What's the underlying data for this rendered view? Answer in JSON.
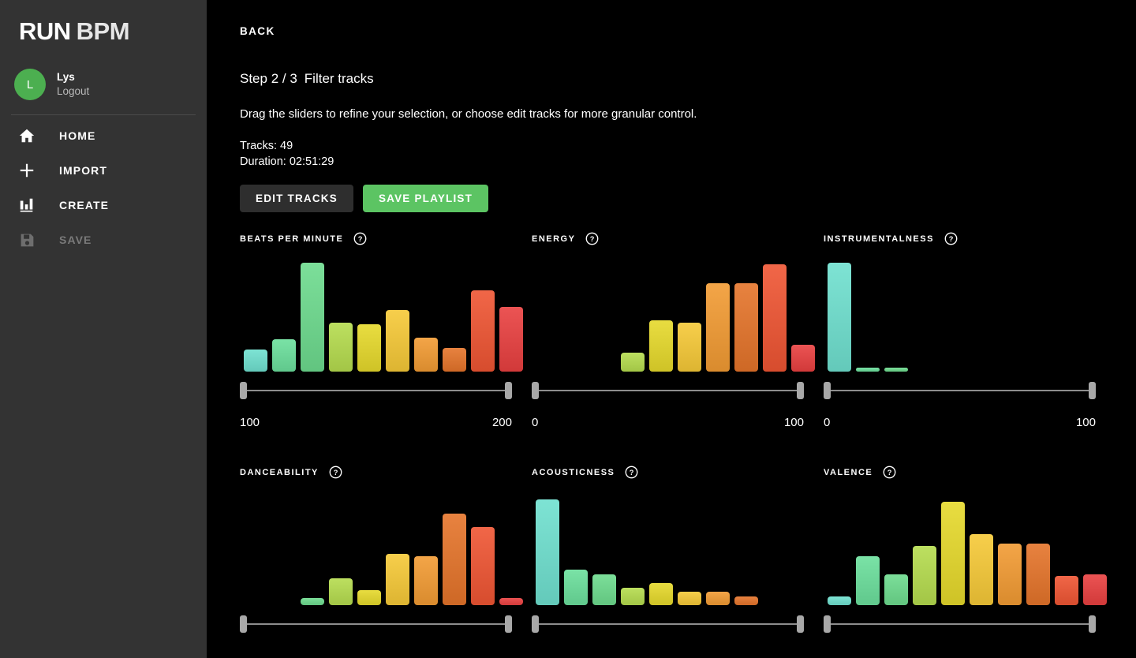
{
  "sidebar": {
    "logo": {
      "part1": "RUN",
      "part2": "BPM"
    },
    "user": {
      "initial": "L",
      "name": "Lys",
      "logout": "Logout",
      "avatar_color": "#4caf50"
    },
    "nav": [
      {
        "label": "HOME",
        "icon": "home-icon",
        "enabled": true
      },
      {
        "label": "IMPORT",
        "icon": "plus-icon",
        "enabled": true
      },
      {
        "label": "CREATE",
        "icon": "bar-chart-icon",
        "enabled": true
      },
      {
        "label": "SAVE",
        "icon": "floppy-disk-icon",
        "enabled": false
      }
    ]
  },
  "main": {
    "back_label": "BACK",
    "step_label": "Step 2 / 3",
    "step_title": "Filter tracks",
    "description": "Drag the sliders to refine your selection, or choose edit tracks for more granular control.",
    "tracks_line": "Tracks: 49",
    "duration_line": "Duration: 02:51:29",
    "edit_tracks_label": "EDIT TRACKS",
    "save_playlist_label": "SAVE PLAYLIST",
    "save_playlist_color": "#5cc463",
    "help_icon": "question-mark-circle-icon"
  },
  "palette": [
    "#6fe0cf",
    "#6bdf9c",
    "#6ddb8e",
    "#b5dc4e",
    "#e6d92b",
    "#f6c937",
    "#f29b33",
    "#e5742a",
    "#ef5533",
    "#e94040"
  ],
  "chart_data": [
    {
      "type": "bar",
      "title": "BEATS PER MINUTE",
      "axis_min": "100",
      "axis_max": "200",
      "categories": [
        "100-110",
        "110-120",
        "120-130",
        "130-140",
        "140-150",
        "150-160",
        "160-170",
        "170-180",
        "180-190",
        "190-200"
      ],
      "values": [
        26,
        38,
        128,
        58,
        56,
        72,
        40,
        28,
        96,
        76
      ],
      "ylim": [
        0,
        130
      ],
      "grid": false,
      "legend": "none"
    },
    {
      "type": "bar",
      "title": "ENERGY",
      "axis_min": "0",
      "axis_max": "100",
      "categories": [
        "0-10",
        "10-20",
        "20-30",
        "30-40",
        "40-50",
        "50-60",
        "60-70",
        "70-80",
        "80-90",
        "90-100"
      ],
      "values": [
        0,
        0,
        0,
        22,
        60,
        58,
        104,
        104,
        126,
        32
      ],
      "ylim": [
        0,
        130
      ],
      "grid": false,
      "legend": "none"
    },
    {
      "type": "bar",
      "title": "INSTRUMENTALNESS",
      "axis_min": "0",
      "axis_max": "100",
      "categories": [
        "0-10",
        "10-20",
        "20-30",
        "30-40",
        "40-50",
        "50-60",
        "60-70",
        "70-80",
        "80-90",
        "90-100"
      ],
      "values": [
        128,
        5,
        5,
        0,
        0,
        0,
        0,
        0,
        0,
        0
      ],
      "ylim": [
        0,
        130
      ],
      "grid": false,
      "legend": "none"
    },
    {
      "type": "bar",
      "title": "DANCEABILITY",
      "axis_min": "",
      "axis_max": "",
      "categories": [
        "0-10",
        "10-20",
        "20-30",
        "30-40",
        "40-50",
        "50-60",
        "60-70",
        "70-80",
        "80-90",
        "90-100"
      ],
      "values": [
        0,
        0,
        8,
        32,
        18,
        60,
        58,
        108,
        92,
        8
      ],
      "ylim": [
        0,
        130
      ],
      "grid": false,
      "legend": "none"
    },
    {
      "type": "bar",
      "title": "ACOUSTICNESS",
      "axis_min": "",
      "axis_max": "",
      "categories": [
        "0-10",
        "10-20",
        "20-30",
        "30-40",
        "40-50",
        "50-60",
        "60-70",
        "70-80",
        "80-90",
        "90-100"
      ],
      "values": [
        124,
        42,
        36,
        20,
        26,
        16,
        16,
        10,
        0,
        0
      ],
      "ylim": [
        0,
        130
      ],
      "grid": false,
      "legend": "none"
    },
    {
      "type": "bar",
      "title": "VALENCE",
      "axis_min": "",
      "axis_max": "",
      "categories": [
        "0-10",
        "10-20",
        "20-30",
        "30-40",
        "40-50",
        "50-60",
        "60-70",
        "70-80",
        "80-90",
        "90-100"
      ],
      "values": [
        10,
        58,
        36,
        70,
        122,
        84,
        72,
        72,
        34,
        36
      ],
      "ylim": [
        0,
        130
      ],
      "grid": false,
      "legend": "none"
    }
  ]
}
